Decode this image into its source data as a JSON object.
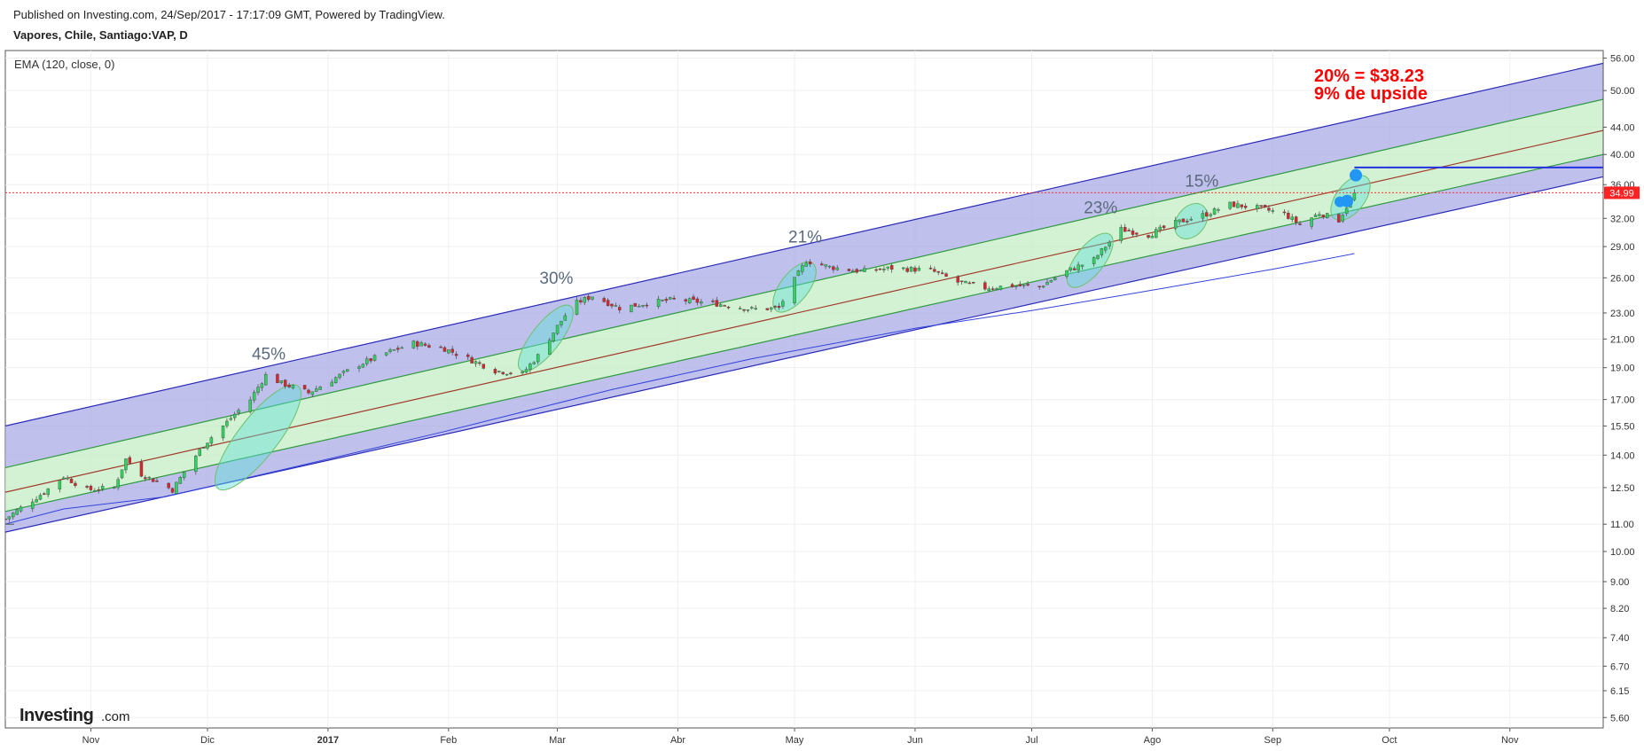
{
  "header": {
    "published": "Published on Investing.com, 24/Sep/2017 - 17:17:09 GMT, Powered by TradingView.",
    "symbol": "Vapores, Chile, Santiago:VAP, D"
  },
  "indicator_label": "EMA (120, close, 0)",
  "logo": {
    "main": "Investing",
    "suffix": ".com"
  },
  "annotation": {
    "line1": "20% = $38.23",
    "line2": "9% de upside"
  },
  "last_price_label": "34.99",
  "colors": {
    "up": "#2fd35f",
    "down": "#d9262b",
    "channel_outer": "#a9abe6",
    "channel_inner": "#c4ecc4",
    "annotation": "#ff0000",
    "ema": "#3344dd"
  },
  "chart_data": {
    "type": "candlestick",
    "scale": "log",
    "ylim": [
      5.4,
      57.5
    ],
    "y_ticks": [
      "56.00",
      "50.00",
      "44.00",
      "40.00",
      "36.00",
      "32.00",
      "29.00",
      "26.00",
      "23.00",
      "21.00",
      "19.00",
      "17.00",
      "15.50",
      "14.00",
      "12.50",
      "11.00",
      "10.00",
      "9.00",
      "8.20",
      "7.40",
      "6.70",
      "6.15",
      "5.60"
    ],
    "x_ticks": [
      {
        "label": "Nov",
        "date": "2016-11-01",
        "bold": false
      },
      {
        "label": "Dic",
        "date": "2016-12-01",
        "bold": false
      },
      {
        "label": "2017",
        "date": "2017-01-01",
        "bold": true
      },
      {
        "label": "Feb",
        "date": "2017-02-01",
        "bold": false
      },
      {
        "label": "Mar",
        "date": "2017-03-01",
        "bold": false
      },
      {
        "label": "Abr",
        "date": "2017-04-01",
        "bold": false
      },
      {
        "label": "May",
        "date": "2017-05-01",
        "bold": false
      },
      {
        "label": "Jun",
        "date": "2017-06-01",
        "bold": false
      },
      {
        "label": "Jul",
        "date": "2017-07-01",
        "bold": false
      },
      {
        "label": "Ago",
        "date": "2017-08-01",
        "bold": false
      },
      {
        "label": "Sep",
        "date": "2017-09-01",
        "bold": false
      },
      {
        "label": "Oct",
        "date": "2017-10-01",
        "bold": false
      },
      {
        "label": "Nov",
        "date": "2017-11-01",
        "bold": false
      }
    ],
    "x_range": [
      "2016-10-10",
      "2017-11-25"
    ],
    "price_path": [
      [
        "2016-10-10",
        11.2
      ],
      [
        "2016-10-20",
        12.3
      ],
      [
        "2016-10-25",
        13.0
      ],
      [
        "2016-10-31",
        12.4
      ],
      [
        "2016-11-07",
        12.5
      ],
      [
        "2016-11-10",
        13.8
      ],
      [
        "2016-11-14",
        13.1
      ],
      [
        "2016-11-22",
        12.4
      ],
      [
        "2016-11-30",
        14.5
      ],
      [
        "2016-12-05",
        15.5
      ],
      [
        "2016-12-12",
        17.0
      ],
      [
        "2016-12-16",
        18.5
      ],
      [
        "2016-12-20",
        18.0
      ],
      [
        "2016-12-27",
        17.4
      ],
      [
        "2017-01-02",
        18.2
      ],
      [
        "2017-01-09",
        19.2
      ],
      [
        "2017-01-16",
        20.0
      ],
      [
        "2017-01-23",
        20.7
      ],
      [
        "2017-01-31",
        20.3
      ],
      [
        "2017-02-06",
        19.6
      ],
      [
        "2017-02-13",
        18.8
      ],
      [
        "2017-02-20",
        18.6
      ],
      [
        "2017-02-24",
        19.8
      ],
      [
        "2017-02-28",
        21.5
      ],
      [
        "2017-03-05",
        23.7
      ],
      [
        "2017-03-10",
        24.4
      ],
      [
        "2017-03-17",
        23.4
      ],
      [
        "2017-03-24",
        23.8
      ],
      [
        "2017-03-31",
        24.1
      ],
      [
        "2017-04-10",
        23.8
      ],
      [
        "2017-04-20",
        23.3
      ],
      [
        "2017-04-27",
        23.4
      ],
      [
        "2017-05-04",
        27.6
      ],
      [
        "2017-05-10",
        27.0
      ],
      [
        "2017-05-18",
        26.6
      ],
      [
        "2017-05-26",
        26.9
      ],
      [
        "2017-06-05",
        26.7
      ],
      [
        "2017-06-12",
        25.6
      ],
      [
        "2017-06-19",
        25.1
      ],
      [
        "2017-06-26",
        25.3
      ],
      [
        "2017-07-03",
        25.2
      ],
      [
        "2017-07-10",
        26.6
      ],
      [
        "2017-07-17",
        27.7
      ],
      [
        "2017-07-24",
        30.8
      ],
      [
        "2017-07-31",
        30.2
      ],
      [
        "2017-08-07",
        31.5
      ],
      [
        "2017-08-15",
        32.5
      ],
      [
        "2017-08-21",
        33.6
      ],
      [
        "2017-08-28",
        33.2
      ],
      [
        "2017-09-04",
        32.5
      ],
      [
        "2017-09-08",
        31.3
      ],
      [
        "2017-09-13",
        32.6
      ],
      [
        "2017-09-18",
        31.8
      ],
      [
        "2017-09-22",
        34.9
      ]
    ],
    "ema": [
      [
        "2016-10-10",
        11.0
      ],
      [
        "2016-10-25",
        11.6
      ],
      [
        "2016-11-20",
        12.1
      ],
      [
        "2016-12-25",
        13.5
      ],
      [
        "2017-01-31",
        15.2
      ],
      [
        "2017-03-15",
        17.6
      ],
      [
        "2017-04-20",
        19.6
      ],
      [
        "2017-06-01",
        21.8
      ],
      [
        "2017-07-01",
        23.2
      ],
      [
        "2017-08-01",
        24.9
      ],
      [
        "2017-09-01",
        26.8
      ],
      [
        "2017-09-22",
        28.3
      ]
    ],
    "channel": {
      "lines": [
        {
          "start": [
            "2016-10-10",
            15.5
          ],
          "end": [
            "2017-11-25",
            55.0
          ]
        },
        {
          "start": [
            "2016-10-10",
            13.4
          ],
          "end": [
            "2017-11-25",
            48.5
          ]
        },
        {
          "start": [
            "2016-10-10",
            12.3
          ],
          "end": [
            "2017-11-25",
            43.5
          ]
        },
        {
          "start": [
            "2016-10-10",
            11.5
          ],
          "end": [
            "2017-11-25",
            40.0
          ]
        },
        {
          "start": [
            "2016-10-10",
            10.7
          ],
          "end": [
            "2017-11-25",
            37.0
          ]
        }
      ]
    },
    "target_line": {
      "value": 38.23,
      "from": "2017-09-22",
      "to": "2017-11-25"
    },
    "last_price": 34.99,
    "moves": [
      {
        "label": "45%",
        "date": "2016-12-14",
        "low": 12.0,
        "high": 18.5
      },
      {
        "label": "30%",
        "date": "2017-02-26",
        "low": 18.4,
        "high": 24.1
      },
      {
        "label": "21%",
        "date": "2017-05-01",
        "low": 22.8,
        "high": 27.8
      },
      {
        "label": "23%",
        "date": "2017-07-16",
        "low": 24.8,
        "high": 30.8
      },
      {
        "label": "15%",
        "date": "2017-08-11",
        "low": 29.7,
        "high": 33.8
      }
    ],
    "last_marker_ellipse": {
      "date": "2017-09-21",
      "low": 31.5,
      "high": 37.5
    }
  }
}
